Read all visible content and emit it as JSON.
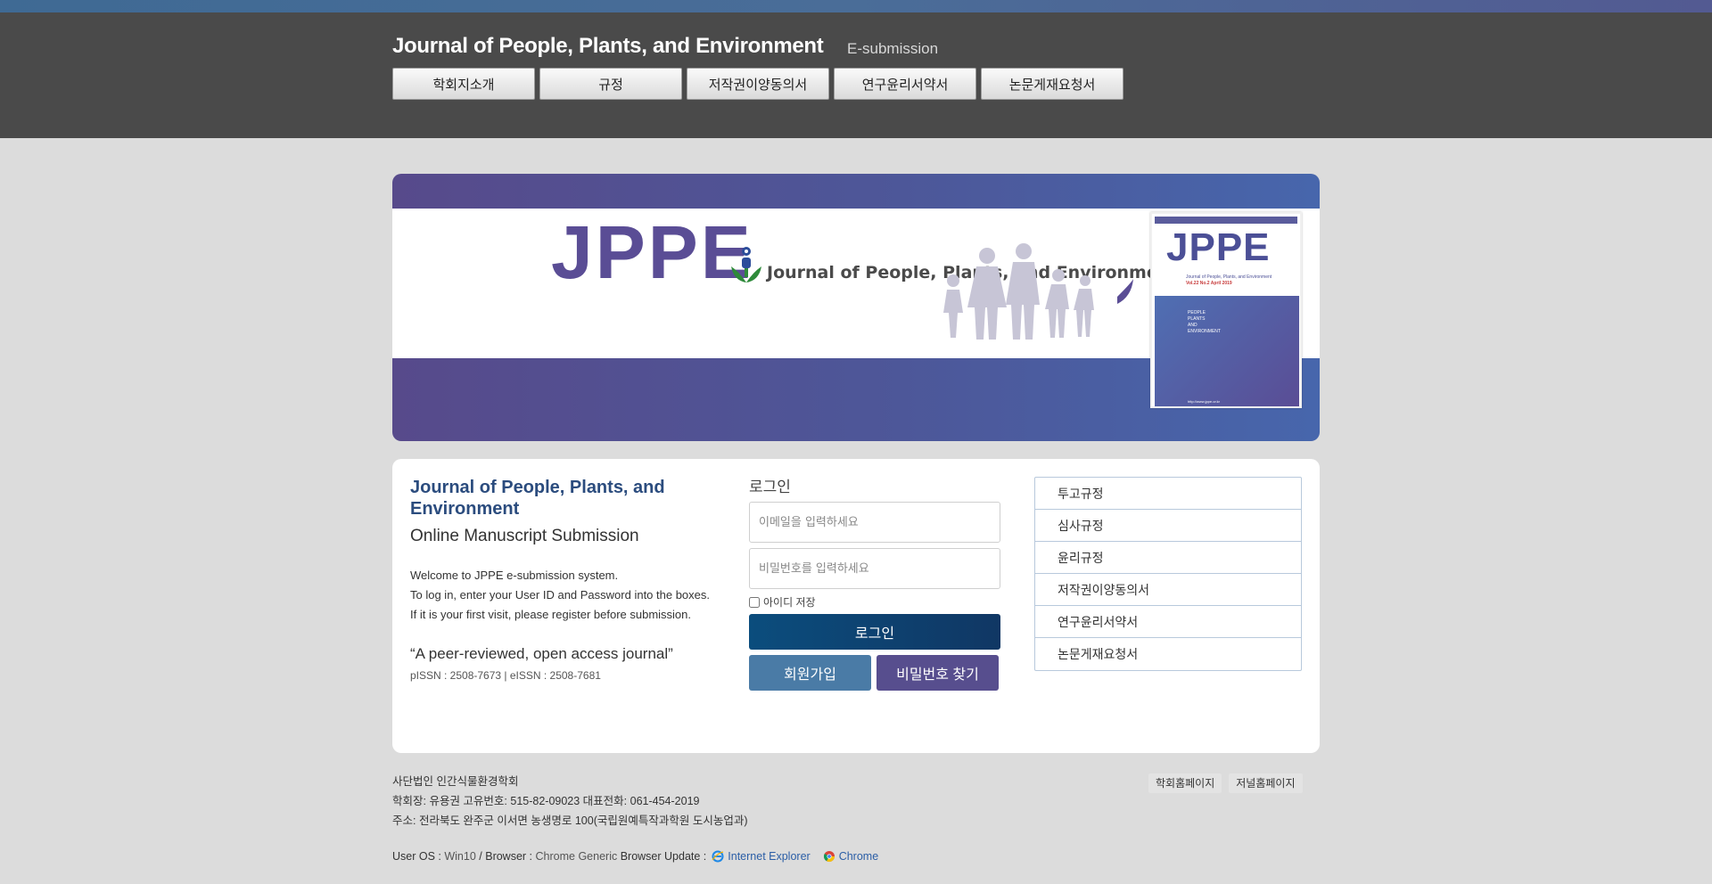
{
  "header": {
    "title": "Journal of People, Plants, and Environment",
    "subtitle": "E-submission",
    "nav": [
      "학회지소개",
      "규정",
      "저작권이양동의서",
      "연구윤리서약서",
      "논문게재요청서"
    ]
  },
  "banner": {
    "logo_text": "JPPE",
    "journal_name": "Journal of People, Plants, and Environment",
    "cover": {
      "logo_text": "JPPE",
      "title": "Journal of People, Plants, and Environment",
      "volume": "Vol.22 No.2 April 2019",
      "words": [
        "PEOPLE",
        "PLANTS",
        "AND",
        "ENVIRONMENT"
      ],
      "url": "http://www.jppe.or.kr"
    }
  },
  "intro": {
    "title": "Journal of People, Plants, and Environment",
    "subtitle": "Online Manuscript Submission",
    "lines": [
      "Welcome to JPPE e-submission system.",
      "To log in, enter your User ID and Password into the boxes.",
      "If it is your first visit, please register before submission."
    ],
    "quote": "“A peer-reviewed, open access journal”",
    "issn": "pISSN : 2508-7673 | eISSN : 2508-7681"
  },
  "login": {
    "title": "로그인",
    "email_placeholder": "이메일을 입력하세요",
    "password_placeholder": "비밀번호를 입력하세요",
    "remember_label": "아이디 저장",
    "login_button": "로그인",
    "join_button": "회원가입",
    "find_password_button": "비밀번호 찾기"
  },
  "rules": [
    "투고규정",
    "심사규정",
    "윤리규정",
    "저작권이양동의서",
    "연구윤리서약서",
    "논문게재요청서"
  ],
  "footer": {
    "lines": [
      "사단법인 인간식물환경학회",
      "학회장: 유용권 고유번호: 515-82-09023 대표전화: 061-454-2019",
      "주소: 전라북도 완주군 이서면 농생명로 100(국립원예특작과학원 도시농업과)"
    ],
    "links": [
      "학회홈페이지",
      "저널홈페이지"
    ],
    "os_label": "User OS :",
    "os_value": "Win10",
    "browser_label": "/ Browser :",
    "browser_value": "Chrome Generic",
    "update_label": "Browser Update :",
    "ie_link": "Internet Explorer",
    "chrome_link": "Chrome"
  },
  "colors": {
    "header_bg": "#4a4a4a",
    "page_bg": "#dcdcdc",
    "brand_purple": "#574e8e",
    "brand_blue": "#4a7ba6",
    "login_navy": "#0b4d7d",
    "title_blue": "#2b4c7e"
  }
}
